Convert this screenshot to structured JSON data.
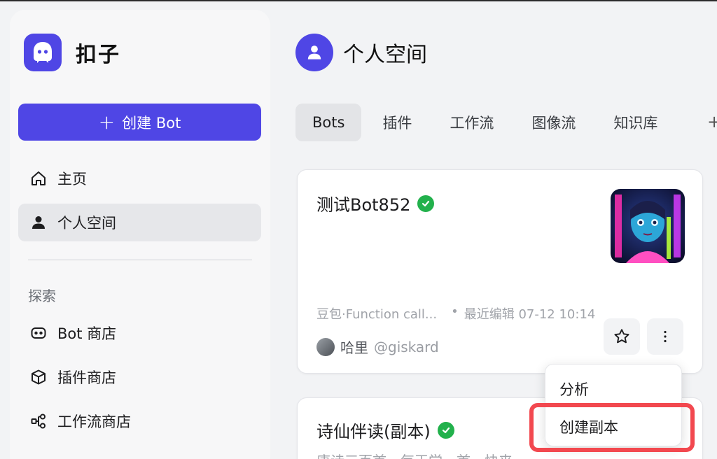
{
  "app": {
    "name": "扣子"
  },
  "sidebar": {
    "create_label": "创建 Bot",
    "nav": [
      {
        "label": "主页",
        "icon": "home-icon"
      },
      {
        "label": "个人空间",
        "icon": "user-icon",
        "active": true
      }
    ],
    "explore_label": "探索",
    "explore": [
      {
        "label": "Bot 商店",
        "icon": "bot-icon"
      },
      {
        "label": "插件商店",
        "icon": "cube-icon"
      },
      {
        "label": "工作流商店",
        "icon": "workflow-icon"
      }
    ]
  },
  "header": {
    "title": "个人空间"
  },
  "tabs": [
    "Bots",
    "插件",
    "工作流",
    "图像流",
    "知识库"
  ],
  "active_tab": "Bots",
  "cards": [
    {
      "title": "测试Bot852",
      "verified": true,
      "meta_model": "豆包·Function call...",
      "meta_edit": "最近编辑 07-12 10:14",
      "author_name": "哈里",
      "author_handle": "@giskard"
    },
    {
      "title": "诗仙伴读(副本)",
      "verified": true,
      "description": "唐诗三百首，每天学一首，快来"
    }
  ],
  "menu": {
    "items": [
      "分析",
      "创建副本"
    ],
    "highlighted": "创建副本"
  },
  "colors": {
    "accent": "#4f46e5",
    "verified": "#22b14c",
    "highlight": "#f2484f"
  }
}
